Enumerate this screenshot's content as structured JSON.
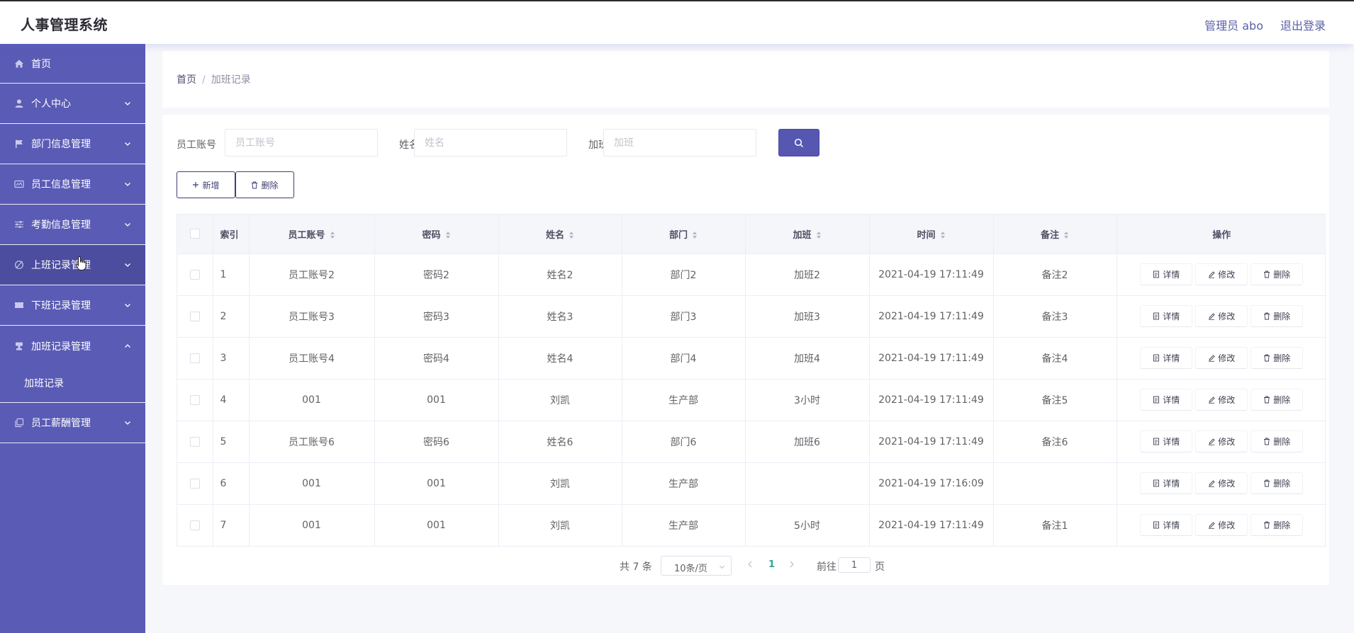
{
  "header": {
    "title": "人事管理系统",
    "admin": "管理员 abo",
    "logout": "退出登录"
  },
  "sidebar": {
    "items": [
      {
        "label": "首页",
        "icon": "home-icon"
      },
      {
        "label": "个人中心",
        "icon": "user-icon"
      },
      {
        "label": "部门信息管理",
        "icon": "flag-icon"
      },
      {
        "label": "员工信息管理",
        "icon": "id-card-icon"
      },
      {
        "label": "考勤信息管理",
        "icon": "sliders-icon"
      },
      {
        "label": "上班记录管理",
        "icon": "disabled-icon"
      },
      {
        "label": "下班记录管理",
        "icon": "ticket-icon"
      },
      {
        "label": "加班记录管理",
        "icon": "stamp-icon"
      },
      {
        "label": "员工薪酬管理",
        "icon": "copy-icon"
      }
    ],
    "sub_item": "加班记录"
  },
  "breadcrumb": {
    "home": "首页",
    "separator": "/",
    "current": "加班记录"
  },
  "search": {
    "account_label": "员工账号",
    "account_placeholder": "员工账号",
    "name_label": "姓名",
    "name_placeholder": "姓名",
    "overtime_label": "加班",
    "overtime_placeholder": "加班"
  },
  "toolbar": {
    "add_label": "新增",
    "delete_label": "删除"
  },
  "table": {
    "headers": {
      "index": "索引",
      "account": "员工账号",
      "password": "密码",
      "name": "姓名",
      "dept": "部门",
      "overtime": "加班",
      "time": "时间",
      "remark": "备注",
      "ops": "操作"
    },
    "op_labels": {
      "detail": "详情",
      "edit": "修改",
      "delete": "删除"
    },
    "rows": [
      {
        "index": "1",
        "account": "员工账号2",
        "password": "密码2",
        "name": "姓名2",
        "dept": "部门2",
        "overtime": "加班2",
        "time": "2021-04-19 17:11:49",
        "remark": "备注2"
      },
      {
        "index": "2",
        "account": "员工账号3",
        "password": "密码3",
        "name": "姓名3",
        "dept": "部门3",
        "overtime": "加班3",
        "time": "2021-04-19 17:11:49",
        "remark": "备注3"
      },
      {
        "index": "3",
        "account": "员工账号4",
        "password": "密码4",
        "name": "姓名4",
        "dept": "部门4",
        "overtime": "加班4",
        "time": "2021-04-19 17:11:49",
        "remark": "备注4"
      },
      {
        "index": "4",
        "account": "001",
        "password": "001",
        "name": "刘凯",
        "dept": "生产部",
        "overtime": "3小时",
        "time": "2021-04-19 17:11:49",
        "remark": "备注5"
      },
      {
        "index": "5",
        "account": "员工账号6",
        "password": "密码6",
        "name": "姓名6",
        "dept": "部门6",
        "overtime": "加班6",
        "time": "2021-04-19 17:11:49",
        "remark": "备注6"
      },
      {
        "index": "6",
        "account": "001",
        "password": "001",
        "name": "刘凯",
        "dept": "生产部",
        "overtime": "",
        "time": "2021-04-19 17:16:09",
        "remark": ""
      },
      {
        "index": "7",
        "account": "001",
        "password": "001",
        "name": "刘凯",
        "dept": "生产部",
        "overtime": "5小时",
        "time": "2021-04-19 17:11:49",
        "remark": "备注1"
      }
    ]
  },
  "pagination": {
    "total": "共 7 条",
    "page_size": "10条/页",
    "current_page": "1",
    "goto_label": "前往",
    "goto_value": "1",
    "page_suffix": "页"
  },
  "colors": {
    "sidebar_bg": "#5a5bb5",
    "sidebar_active": "#4c4d9f",
    "primary": "#5557b1",
    "page_active": "#2aa59a"
  }
}
